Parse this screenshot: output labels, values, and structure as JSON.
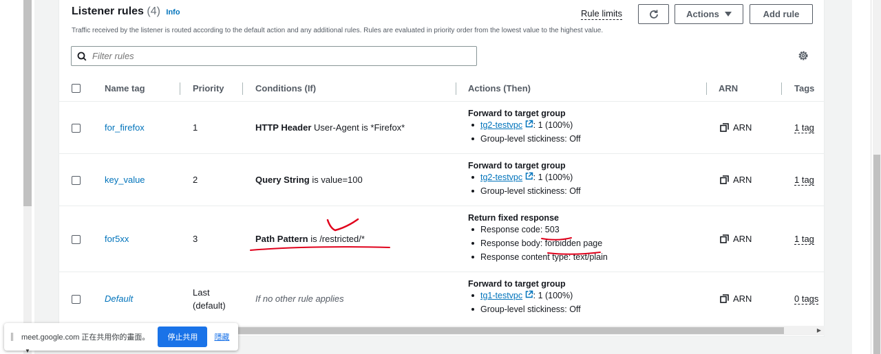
{
  "listener": {
    "title": "Listener rules",
    "count": "(4)",
    "info": "Info",
    "description": "Traffic received by the listener is routed according to the default action and any additional rules. Rules are evaluated in priority order from the lowest value to the highest value.",
    "rule_limits": "Rule limits",
    "actions_label": "Actions",
    "add_rule_label": "Add rule",
    "filter_placeholder": "Filter rules"
  },
  "table": {
    "headers": [
      "Name tag",
      "Priority",
      "Conditions (If)",
      "Actions (Then)",
      "ARN",
      "Tags"
    ],
    "rows": [
      {
        "name": "for_firefox",
        "priority": "1",
        "cond_key": "HTTP Header",
        "cond_rest": " User-Agent is *Firefox*",
        "action_title": "Forward to target group",
        "target_link": "tg2-testvpc",
        "target_weight": ": 1 (100%)",
        "stickiness": "Group-level stickiness: Off",
        "arn": "ARN",
        "tags": "1 tag"
      },
      {
        "name": "key_value",
        "priority": "2",
        "cond_key": "Query String",
        "cond_rest": " is value=100",
        "action_title": "Forward to target group",
        "target_link": "tg2-testvpc",
        "target_weight": ": 1 (100%)",
        "stickiness": "Group-level stickiness: Off",
        "arn": "ARN",
        "tags": "1 tag"
      },
      {
        "name": "for5xx",
        "priority": "3",
        "cond_key": "Path Pattern",
        "cond_rest": " is /restricted/*",
        "action_title": "Return fixed response",
        "response_code": "Response code: 503",
        "response_body": "Response body: forbidden page",
        "response_type": "Response content type: text/plain",
        "arn": "ARN",
        "tags": "1 tag"
      },
      {
        "name": "Default",
        "priority_line1": "Last",
        "priority_line2": "(default)",
        "condition": "If no other rule applies",
        "action_title": "Forward to target group",
        "target_link": "tg1-testvpc",
        "target_weight": ": 1 (100%)",
        "stickiness": "Group-level stickiness: Off",
        "arn": "ARN",
        "tags": "0 tags"
      }
    ]
  },
  "share_bar": {
    "message": "meet.google.com 正在共用你的畫面。",
    "stop_label": "停止共用",
    "hide_label": "隱藏"
  },
  "colors": {
    "link": "#0073bb",
    "annotation": "#e0001b",
    "share_button": "#1a73e8"
  },
  "icons": [
    "refresh-icon",
    "caret-down-icon",
    "search-icon",
    "gear-icon",
    "external-link-icon",
    "copy-icon",
    "grip-icon"
  ]
}
